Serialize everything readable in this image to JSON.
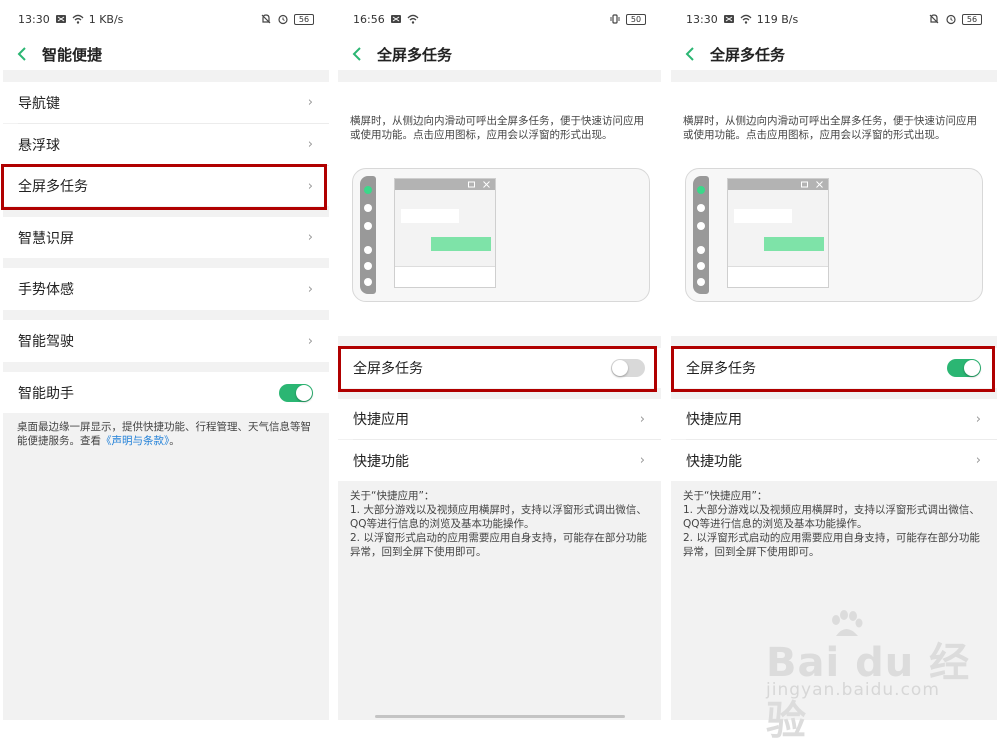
{
  "panel1": {
    "status": {
      "time": "13:30",
      "speed": "1 KB/s",
      "battery": "56"
    },
    "title": "智能便捷",
    "items": [
      {
        "label": "导航键",
        "chevron": "›"
      },
      {
        "label": "悬浮球",
        "chevron": "›"
      },
      {
        "label": "全屏多任务",
        "chevron": "›"
      },
      {
        "label": "智慧识屏",
        "chevron": "›"
      },
      {
        "label": "手势体感",
        "chevron": "›"
      },
      {
        "label": "智能驾驶",
        "chevron": "›"
      }
    ],
    "assistant": {
      "label": "智能助手",
      "toggle_on": true
    },
    "assistant_desc": "桌面最边缘一屏显示，提供快捷功能、行程管理、天气信息等智能便捷服务。查看",
    "assistant_link": "《声明与条款》",
    "assistant_desc_end": "。"
  },
  "panel2": {
    "status": {
      "time": "16:56",
      "battery": "50"
    },
    "title": "全屏多任务",
    "intro": "横屏时，从侧边向内滑动可呼出全屏多任务，便于快速访问应用或使用功能。点击应用图标，应用会以浮窗的形式出现。",
    "toggle_label": "全屏多任务",
    "toggle_on": false,
    "rows": [
      {
        "label": "快捷应用",
        "chevron": "›"
      },
      {
        "label": "快捷功能",
        "chevron": "›"
      }
    ],
    "notes": [
      "关于“快捷应用”：",
      "1. 大部分游戏以及视频应用横屏时，支持以浮窗形式调出微信、QQ等进行信息的浏览及基本功能操作。",
      "2. 以浮窗形式启动的应用需要应用自身支持，可能存在部分功能异常，回到全屏下使用即可。"
    ]
  },
  "panel3": {
    "status": {
      "time": "13:30",
      "speed": "119 B/s",
      "battery": "56"
    },
    "title": "全屏多任务",
    "intro": "横屏时，从侧边向内滑动可呼出全屏多任务，便于快速访问应用或使用功能。点击应用图标，应用会以浮窗的形式出现。",
    "toggle_label": "全屏多任务",
    "toggle_on": true,
    "rows": [
      {
        "label": "快捷应用",
        "chevron": "›"
      },
      {
        "label": "快捷功能",
        "chevron": "›"
      }
    ],
    "notes": [
      "关于“快捷应用”：",
      "1. 大部分游戏以及视频应用横屏时，支持以浮窗形式调出微信、QQ等进行信息的浏览及基本功能操作。",
      "2. 以浮窗形式启动的应用需要应用自身支持，可能存在部分功能异常，回到全屏下使用即可。"
    ]
  },
  "watermark": {
    "brand": "Bai du 经验",
    "url": "jingyan.baidu.com"
  },
  "colors": {
    "accent_green": "#2bb673",
    "highlight_red": "#b00000",
    "link_blue": "#1e7fd8"
  },
  "icons": [
    "back-arrow-icon",
    "wifi-icon",
    "alarm-icon",
    "bell-mute-icon",
    "vibrate-icon",
    "battery-icon",
    "minimize-icon",
    "close-icon"
  ]
}
